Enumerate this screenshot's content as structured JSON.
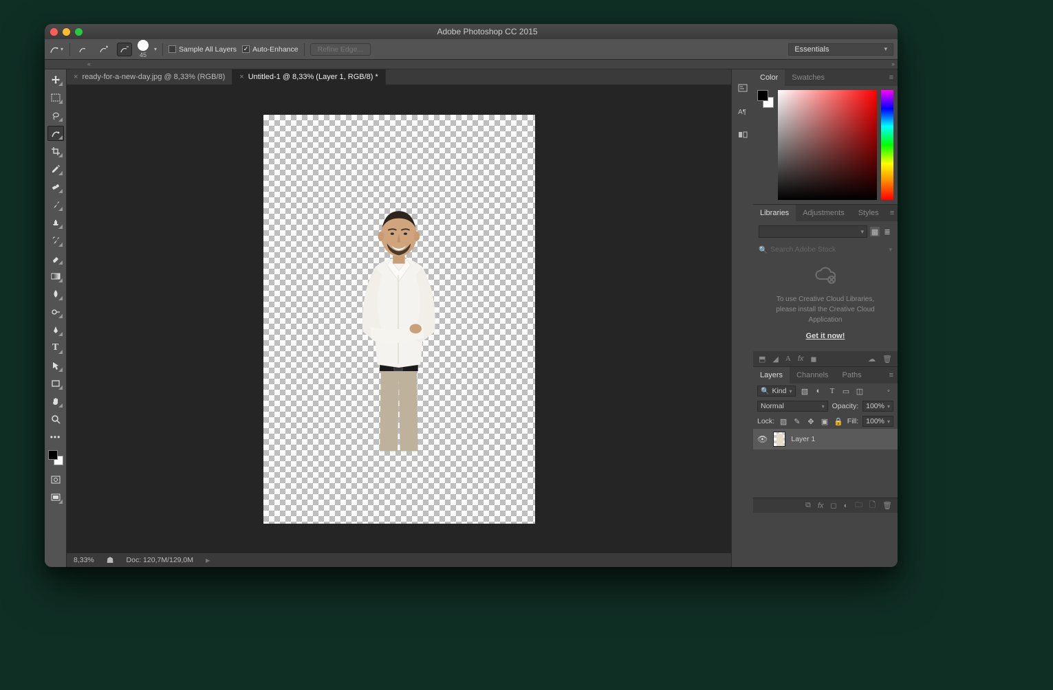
{
  "title": "Adobe Photoshop CC 2015",
  "optionsBar": {
    "brushSize": "45",
    "sampleAllLayers": "Sample All Layers",
    "autoEnhance": "Auto-Enhance",
    "refineEdge": "Refine Edge...",
    "workspace": "Essentials"
  },
  "tabs": {
    "inactive": "ready-for-a-new-day.jpg @ 8,33% (RGB/8)",
    "active": "Untitled-1 @ 8,33% (Layer 1, RGB/8) *"
  },
  "statusBar": {
    "zoom": "8,33%",
    "doc": "Doc: 120,7M/129,0M"
  },
  "panels": {
    "color": {
      "tabColor": "Color",
      "tabSwatches": "Swatches"
    },
    "libraries": {
      "tabLibraries": "Libraries",
      "tabAdjustments": "Adjustments",
      "tabStyles": "Styles",
      "searchPlaceholder": "Search Adobe Stock",
      "msg1": "To use Creative Cloud Libraries,",
      "msg2": "please install the Creative Cloud",
      "msg3": "Application",
      "getItNow": "Get it now!",
      "fx": "fx"
    },
    "layers": {
      "tabLayers": "Layers",
      "tabChannels": "Channels",
      "tabPaths": "Paths",
      "filterKind": "Kind",
      "blendMode": "Normal",
      "opacityLabel": "Opacity:",
      "opacityValue": "100%",
      "lockLabel": "Lock:",
      "fillLabel": "Fill:",
      "fillValue": "100%",
      "layer1": "Layer 1",
      "fx": "fx"
    }
  }
}
